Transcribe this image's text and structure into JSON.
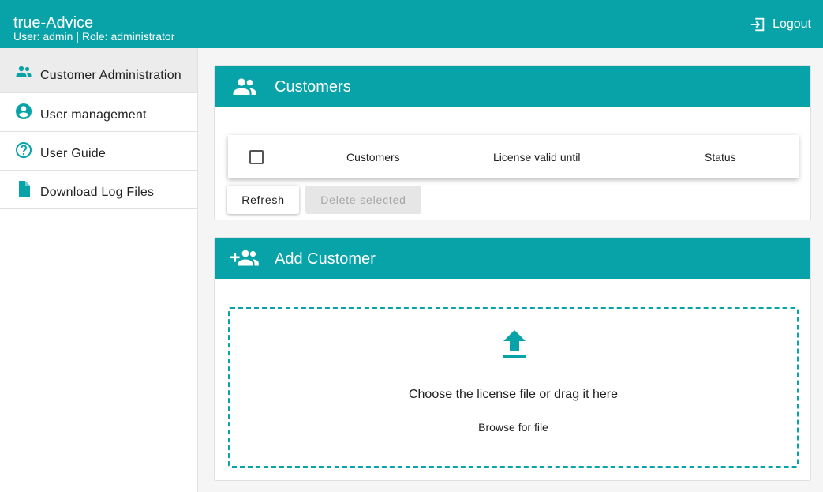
{
  "header": {
    "title": "true-Advice",
    "user_info": "User: admin | Role: administrator",
    "logout_label": "Logout"
  },
  "sidebar": {
    "items": [
      {
        "label": "Customer Administration",
        "icon": "group-icon",
        "active": true
      },
      {
        "label": "User management",
        "icon": "account-circle-icon"
      },
      {
        "label": "User Guide",
        "icon": "help-circle-icon"
      },
      {
        "label": "Download Log Files",
        "icon": "file-icon"
      }
    ]
  },
  "customers_card": {
    "title": "Customers",
    "columns": [
      "Customers",
      "License valid until",
      "Status"
    ],
    "refresh_label": "Refresh",
    "delete_label": "Delete selected"
  },
  "add_card": {
    "title": "Add Customer",
    "drop_text": "Choose the license file or drag it here",
    "browse_label": "Browse for file"
  },
  "colors": {
    "accent": "#07a3a8"
  }
}
